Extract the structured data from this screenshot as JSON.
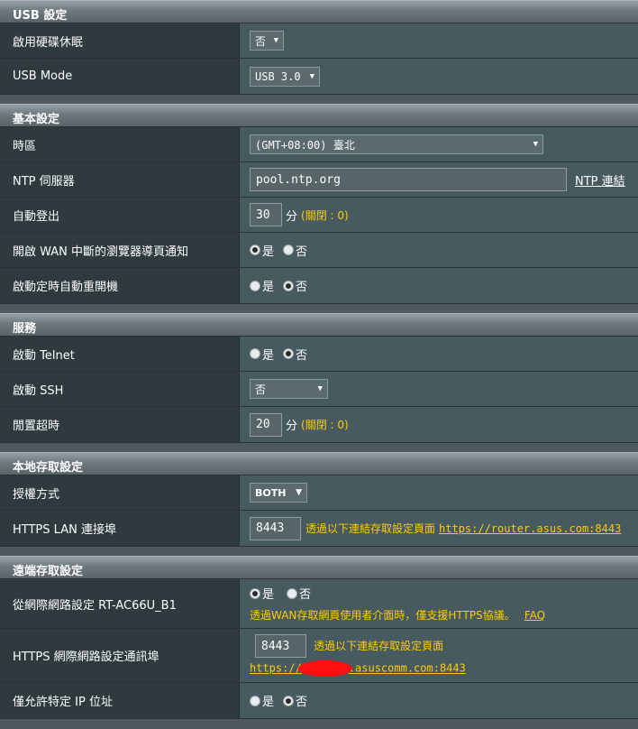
{
  "usb": {
    "title": "USB 設定",
    "hdd_hibernate": {
      "label": "啟用硬碟休眠",
      "value": "否"
    },
    "usb_mode": {
      "label": "USB Mode",
      "value": "USB 3.0"
    }
  },
  "basic": {
    "title": "基本設定",
    "timezone": {
      "label": "時區",
      "value": "(GMT+08:00) 臺北"
    },
    "ntp": {
      "label": "NTP 伺服器",
      "value": "pool.ntp.org",
      "link": "NTP 連結"
    },
    "auto_logout": {
      "label": "自動登出",
      "value": "30",
      "unit": "分",
      "hint": "(關閉 : 0)"
    },
    "wan_notify": {
      "label": "開啟 WAN 中斷的瀏覽器導頁通知",
      "yes": "是",
      "no": "否",
      "selected": "yes"
    },
    "auto_reboot": {
      "label": "啟動定時自動重開機",
      "yes": "是",
      "no": "否",
      "selected": "no"
    }
  },
  "service": {
    "title": "服務",
    "telnet": {
      "label": "啟動 Telnet",
      "yes": "是",
      "no": "否",
      "selected": "no"
    },
    "ssh": {
      "label": "啟動 SSH",
      "value": "否"
    },
    "idle_timeout": {
      "label": "閒置超時",
      "value": "20",
      "unit": "分",
      "hint": "(關閉 : 0)"
    }
  },
  "local_access": {
    "title": "本地存取設定",
    "auth_method": {
      "label": "授權方式",
      "value": "BOTH"
    },
    "https_lan_port": {
      "label": "HTTPS LAN 連接埠",
      "value": "8443",
      "hint": "透過以下連結存取設定頁面",
      "url": "https://router.asus.com:8443"
    }
  },
  "remote_access": {
    "title": "遠端存取設定",
    "wan_access": {
      "label": "從網際網路設定 RT-AC66U_B1",
      "yes": "是",
      "no": "否",
      "selected": "yes",
      "hint": "透過WAN存取網頁使用者介面時，僅支援HTTPS協議。",
      "faq": "FAQ"
    },
    "https_wan_port": {
      "label": "HTTPS 網際網路設定通訊埠",
      "value": "8443",
      "hint": "透過以下連結存取設定頁面",
      "url_prefix": "https://",
      "url_suffix": ".asuscomm.com:8443"
    },
    "allow_ip": {
      "label": "僅允許特定 IP 位址",
      "yes": "是",
      "no": "否",
      "selected": "no"
    }
  },
  "colors": {
    "accent_text": "#ffcc00",
    "row_label_bg": "#2e3a3e",
    "row_value_bg": "#475a5f"
  }
}
